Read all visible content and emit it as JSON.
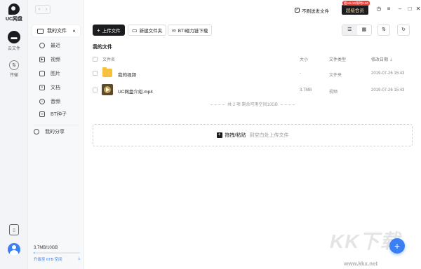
{
  "app": {
    "logo_text": "UC网盘"
  },
  "rail": {
    "items": [
      {
        "label": "云文件"
      },
      {
        "label": "传输"
      }
    ]
  },
  "sidebar": {
    "root": "我的文件",
    "items": [
      {
        "label": "最近"
      },
      {
        "label": "视频"
      },
      {
        "label": "图片"
      },
      {
        "label": "文档"
      },
      {
        "label": "音频"
      },
      {
        "label": "BT种子"
      }
    ],
    "share": "我的分享",
    "storage": {
      "used": "3.7MB/10GB",
      "upgrade": "升级至 6TB 空间",
      "fraction": 0.01
    }
  },
  "titlebar": {
    "no_feed": "不刷送发文件",
    "vip_badge": "超V6.0G限时5.00",
    "vip": "超级会员"
  },
  "toolbar": {
    "upload": "上传文件",
    "new_folder": "新建文件夹",
    "bt": "BT/磁力链下载"
  },
  "main": {
    "breadcrumb": "我的文件",
    "columns": {
      "name": "文件名",
      "size": "大小",
      "type": "文件类型",
      "date": "修改日期"
    },
    "files": [
      {
        "name": "我的视频",
        "size": "-",
        "type": "文件夹",
        "date": "2019-07-26 15:43"
      },
      {
        "name": "UC网盘介绍.mp4",
        "size": "3.7MB",
        "type": "视频",
        "date": "2019-07-26 15:43"
      }
    ],
    "summary": "共 2 项  剩余可用空间10GB",
    "drop_label": "拖拽/粘贴",
    "drop_hint": "到空白处上传文件"
  },
  "watermark": {
    "text": "KK下载",
    "url": "www.kkx.net"
  },
  "colors": {
    "accent": "#3a7ff5",
    "dark": "#1b1c20",
    "folder": "#f6c13d"
  }
}
